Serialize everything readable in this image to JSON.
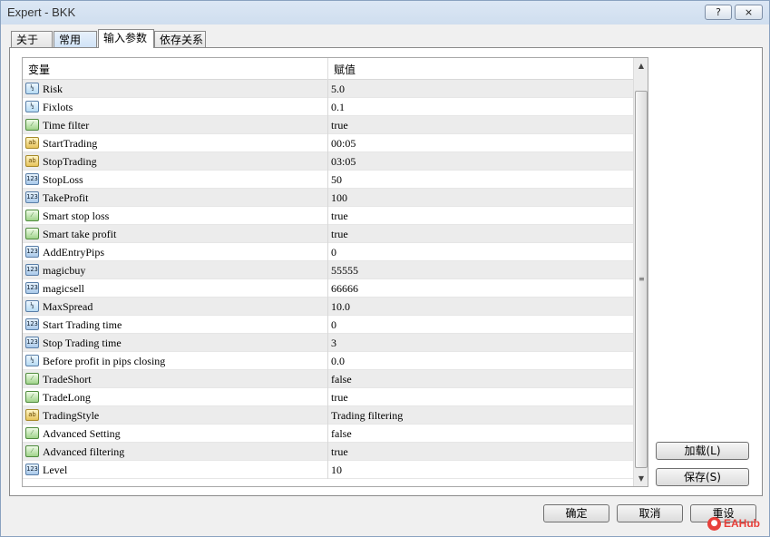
{
  "window": {
    "title": "Expert - BKK",
    "help_label": "?",
    "close_label": "⨯"
  },
  "tabs": [
    {
      "label": "关于"
    },
    {
      "label": "常用"
    },
    {
      "label": "输入参数",
      "active": true
    },
    {
      "label": "依存关系"
    }
  ],
  "grid": {
    "col_variable": "变量",
    "col_value": "赋值",
    "rows": [
      {
        "icon": "double-icon",
        "name": "Risk",
        "value": "5.0"
      },
      {
        "icon": "double-icon",
        "name": "Fixlots",
        "value": "0.1"
      },
      {
        "icon": "bool-icon",
        "name": "Time filter",
        "value": "true"
      },
      {
        "icon": "string-icon",
        "name": "StartTrading",
        "value": "00:05"
      },
      {
        "icon": "string-icon",
        "name": "StopTrading",
        "value": "03:05"
      },
      {
        "icon": "integer-icon",
        "name": "StopLoss",
        "value": "50"
      },
      {
        "icon": "integer-icon",
        "name": "TakeProfit",
        "value": "100"
      },
      {
        "icon": "bool-icon",
        "name": "Smart stop loss",
        "value": "true"
      },
      {
        "icon": "bool-icon",
        "name": "Smart take profit",
        "value": "true"
      },
      {
        "icon": "integer-icon",
        "name": "AddEntryPips",
        "value": "0"
      },
      {
        "icon": "integer-icon",
        "name": "magicbuy",
        "value": "55555"
      },
      {
        "icon": "integer-icon",
        "name": "magicsell",
        "value": "66666"
      },
      {
        "icon": "double-icon",
        "name": "MaxSpread",
        "value": "10.0"
      },
      {
        "icon": "integer-icon",
        "name": "Start Trading time",
        "value": "0"
      },
      {
        "icon": "integer-icon",
        "name": "Stop Trading time",
        "value": "3"
      },
      {
        "icon": "double-icon",
        "name": "Before profit in pips closing",
        "value": "0.0"
      },
      {
        "icon": "bool-icon",
        "name": "TradeShort",
        "value": "false"
      },
      {
        "icon": "bool-icon",
        "name": "TradeLong",
        "value": "true"
      },
      {
        "icon": "string-icon",
        "name": "TradingStyle",
        "value": "Trading filtering"
      },
      {
        "icon": "bool-icon",
        "name": "Advanced Setting",
        "value": "false"
      },
      {
        "icon": "bool-icon",
        "name": "Advanced filtering",
        "value": "true"
      },
      {
        "icon": "integer-icon",
        "name": "Level",
        "value": "10"
      }
    ]
  },
  "icon_glyphs": {
    "integer-icon": "123",
    "double-icon": "½",
    "string-icon": "ab",
    "bool-icon": "⁄"
  },
  "side_buttons": {
    "load_label": "加载(L)",
    "save_label": "保存(S)"
  },
  "footer": {
    "ok_label": "确定",
    "cancel_label": "取消",
    "reset_label": "重设"
  },
  "watermark": {
    "text": "EAHub"
  },
  "colors": {
    "accent": "#5a7fa8",
    "row_alt": "#ececec",
    "watermark": "#e8403a"
  }
}
